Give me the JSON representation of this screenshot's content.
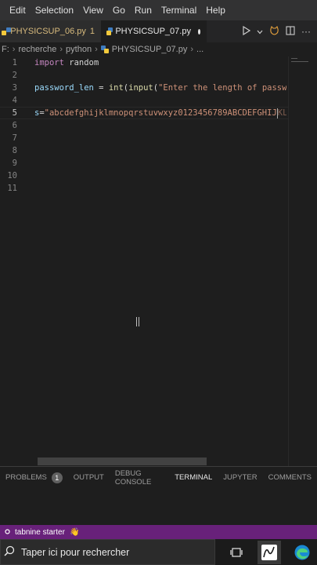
{
  "menubar": {
    "items": [
      "Edit",
      "Selection",
      "View",
      "Go",
      "Run",
      "Terminal",
      "Help"
    ]
  },
  "tabs": [
    {
      "label": "PHYSICSUP_06.py",
      "suffix": "1",
      "state": "inactive",
      "color": "#d7ba7d"
    },
    {
      "label": "PHYSICSUP_07.py",
      "suffix": "",
      "state": "active",
      "dirty": true
    }
  ],
  "breadcrumb": {
    "items": [
      "F:",
      "recherche",
      "python",
      "PHYSICSUP_07.py",
      "..."
    ]
  },
  "editor": {
    "lines": [
      {
        "number": "1",
        "code": "import random"
      },
      {
        "number": "2",
        "code": ""
      },
      {
        "number": "3",
        "code": "password_len = int(input(\"Enter the length of passw"
      },
      {
        "number": "4",
        "code": ""
      },
      {
        "number": "5",
        "code": "s=\"abcdefghijklmnopqrstuvwxyz0123456789ABCDEFGHIJKL"
      },
      {
        "number": "6",
        "code": ""
      },
      {
        "number": "7",
        "code": ""
      },
      {
        "number": "8",
        "code": ""
      },
      {
        "number": "9",
        "code": ""
      },
      {
        "number": "10",
        "code": ""
      },
      {
        "number": "11",
        "code": ""
      }
    ],
    "active_line": "5",
    "tokens": {
      "line1_kw": "import",
      "line1_mod": " random",
      "line3_var": "password_len",
      "line3_op": " = ",
      "line3_fn1": "int",
      "line3_p1": "(",
      "line3_fn2": "input",
      "line3_p2": "(",
      "line3_str": "\"Enter the length of passw",
      "line5_var": "s",
      "line5_op": "=",
      "line5_str": "\"abcdefghijklmnopqrstuvwxyz0123456789ABCDEFGHIJ",
      "line5_tail": "KL"
    }
  },
  "panel": {
    "tabs": [
      {
        "label": "PROBLEMS",
        "badge": "1"
      },
      {
        "label": "OUTPUT"
      },
      {
        "label": "DEBUG CONSOLE"
      },
      {
        "label": "TERMINAL",
        "active": true
      },
      {
        "label": "JUPYTER"
      },
      {
        "label": "COMMENTS"
      }
    ]
  },
  "statusbar": {
    "text": "tabnine starter",
    "color": "#68217a"
  },
  "taskbar": {
    "search_placeholder": "Taper ici pour rechercher"
  },
  "colors": {
    "keyword": "#c586c0",
    "function": "#dcdcaa",
    "variable": "#9cdcfe",
    "string": "#ce9178",
    "editor_bg": "#1e1e1e"
  }
}
